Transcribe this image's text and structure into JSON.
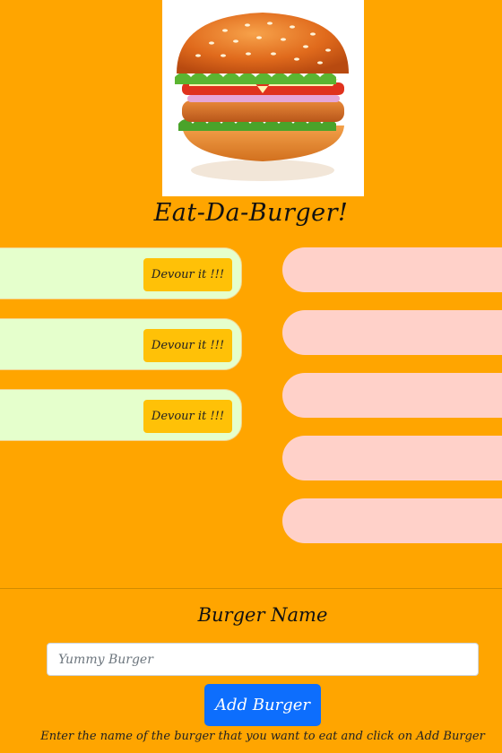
{
  "header": {
    "image": "burger-image",
    "title": "Eat-Da-Burger!"
  },
  "uneaten_burgers": [
    {
      "button_label": "Devour it !!!"
    },
    {
      "button_label": "Devour it !!!"
    },
    {
      "button_label": "Devour it !!!"
    }
  ],
  "eaten_burgers": [
    {
      "name": ""
    },
    {
      "name": ""
    },
    {
      "name": ""
    },
    {
      "name": ""
    },
    {
      "name": ""
    }
  ],
  "form": {
    "label": "Burger Name",
    "input_placeholder": "Yummy Burger",
    "input_value": "",
    "submit_label": "Add Burger",
    "hint": "Enter the name of the burger that you want to eat and click on Add Burger"
  },
  "colors": {
    "background": "#FFA500",
    "uneaten_card": "#E5FFCC",
    "eaten_card": "#FFD1C9",
    "devour_button": "#FFC107",
    "primary_button": "#0D6EFD"
  }
}
